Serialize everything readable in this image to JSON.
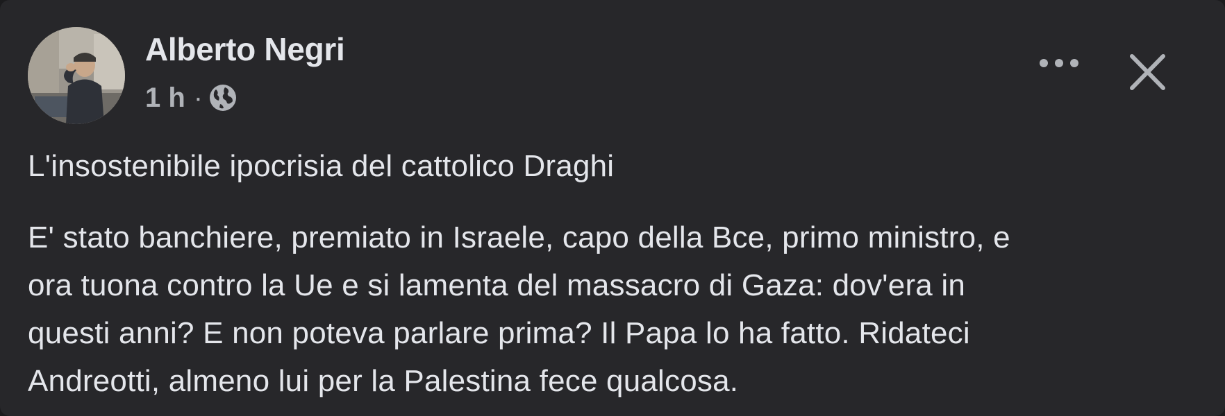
{
  "post": {
    "author": "Alberto Negri",
    "time": "1 h",
    "separator": "·",
    "visibility_icon": "globe-icon",
    "title": "L'insostenibile ipocrisia del cattolico Draghi",
    "body_lines": [
      "E' stato banchiere, premiato in Israele, capo della Bce, primo ministro, e",
      "ora tuona contro la Ue e si lamenta del massacro di Gaza: dov'era in",
      "questi anni? E non poteva parlare prima? Il Papa lo ha fatto. Ridateci",
      "Andreotti, almeno lui per la Palestina fece qualcosa."
    ]
  },
  "actions": {
    "more_icon": "more-options-icon",
    "close_icon": "close-icon"
  },
  "colors": {
    "card_background": "#27272a",
    "primary_text": "#e4e6eb",
    "secondary_text": "#b0b3b8"
  }
}
